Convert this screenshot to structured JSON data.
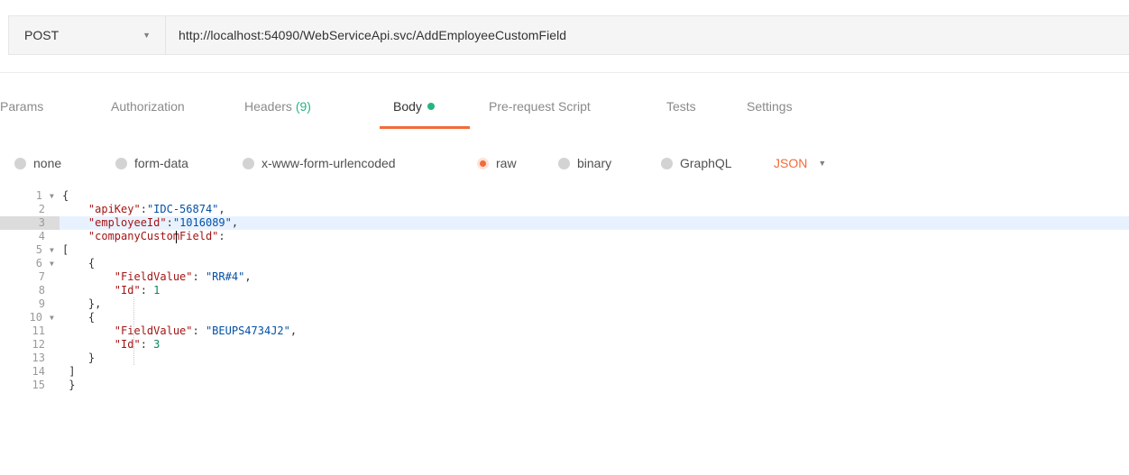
{
  "request": {
    "method": "POST",
    "url": "http://localhost:54090/WebServiceApi.svc/AddEmployeeCustomField"
  },
  "tabs": [
    {
      "label": "Params",
      "count": ""
    },
    {
      "label": "Authorization",
      "count": ""
    },
    {
      "label": "Headers",
      "count": "(9)"
    },
    {
      "label": "Body",
      "count": "",
      "active": true
    },
    {
      "label": "Pre-request Script",
      "count": ""
    },
    {
      "label": "Tests",
      "count": ""
    },
    {
      "label": "Settings",
      "count": ""
    }
  ],
  "body_types": [
    {
      "label": "none"
    },
    {
      "label": "form-data"
    },
    {
      "label": "x-www-form-urlencoded"
    },
    {
      "label": "raw",
      "selected": true
    },
    {
      "label": "binary"
    },
    {
      "label": "GraphQL"
    }
  ],
  "raw_language": "JSON",
  "editor": {
    "highlighted_line": 3,
    "lines": [
      {
        "n": "1",
        "fold": true,
        "segments": [
          {
            "t": "p",
            "v": "{"
          }
        ]
      },
      {
        "n": "2",
        "fold": false,
        "segments": [
          {
            "t": "p",
            "v": "    "
          },
          {
            "t": "k",
            "v": "\"apiKey\""
          },
          {
            "t": "p",
            "v": ":"
          },
          {
            "t": "s",
            "v": "\"IDC-56874\""
          },
          {
            "t": "p",
            "v": ","
          }
        ]
      },
      {
        "n": "3",
        "fold": false,
        "segments": [
          {
            "t": "p",
            "v": "    "
          },
          {
            "t": "k",
            "v": "\"employeeId\""
          },
          {
            "t": "p",
            "v": ":"
          },
          {
            "t": "s",
            "v": "\"1016089\""
          },
          {
            "t": "p",
            "v": ","
          }
        ]
      },
      {
        "n": "4",
        "fold": false,
        "segments": [
          {
            "t": "p",
            "v": "    "
          },
          {
            "t": "k",
            "v": "\"companyCustomField\""
          },
          {
            "t": "p",
            "v": ":"
          }
        ]
      },
      {
        "n": "5",
        "fold": true,
        "segments": [
          {
            "t": "p",
            "v": "["
          }
        ]
      },
      {
        "n": "6",
        "fold": true,
        "segments": [
          {
            "t": "p",
            "v": "    {"
          }
        ]
      },
      {
        "n": "7",
        "fold": false,
        "segments": [
          {
            "t": "p",
            "v": "        "
          },
          {
            "t": "k",
            "v": "\"FieldValue\""
          },
          {
            "t": "p",
            "v": ": "
          },
          {
            "t": "s",
            "v": "\"RR#4\""
          },
          {
            "t": "p",
            "v": ","
          }
        ]
      },
      {
        "n": "8",
        "fold": false,
        "segments": [
          {
            "t": "p",
            "v": "        "
          },
          {
            "t": "k",
            "v": "\"Id\""
          },
          {
            "t": "p",
            "v": ": "
          },
          {
            "t": "n",
            "v": "1"
          }
        ]
      },
      {
        "n": "9",
        "fold": false,
        "segments": [
          {
            "t": "p",
            "v": "    },"
          }
        ]
      },
      {
        "n": "10",
        "fold": true,
        "segments": [
          {
            "t": "p",
            "v": "    {"
          }
        ]
      },
      {
        "n": "11",
        "fold": false,
        "segments": [
          {
            "t": "p",
            "v": "        "
          },
          {
            "t": "k",
            "v": "\"FieldValue\""
          },
          {
            "t": "p",
            "v": ": "
          },
          {
            "t": "s",
            "v": "\"BEUPS4734J2\""
          },
          {
            "t": "p",
            "v": ","
          }
        ]
      },
      {
        "n": "12",
        "fold": false,
        "segments": [
          {
            "t": "p",
            "v": "        "
          },
          {
            "t": "k",
            "v": "\"Id\""
          },
          {
            "t": "p",
            "v": ": "
          },
          {
            "t": "n",
            "v": "3"
          }
        ]
      },
      {
        "n": "13",
        "fold": false,
        "segments": [
          {
            "t": "p",
            "v": "    }"
          }
        ]
      },
      {
        "n": "14",
        "fold": false,
        "segments": [
          {
            "t": "p",
            "v": " ]"
          }
        ]
      },
      {
        "n": "15",
        "fold": false,
        "segments": [
          {
            "t": "p",
            "v": " }"
          }
        ]
      }
    ]
  },
  "colors": {
    "accent": "#f26b3a",
    "success": "#26b47f",
    "json_key": "#a31515",
    "json_string": "#0451a5",
    "json_number": "#098658"
  },
  "icons": {
    "method_dropdown": "caret-down-icon",
    "language_dropdown": "caret-down-icon",
    "fold_marker": "fold-arrow-icon"
  }
}
